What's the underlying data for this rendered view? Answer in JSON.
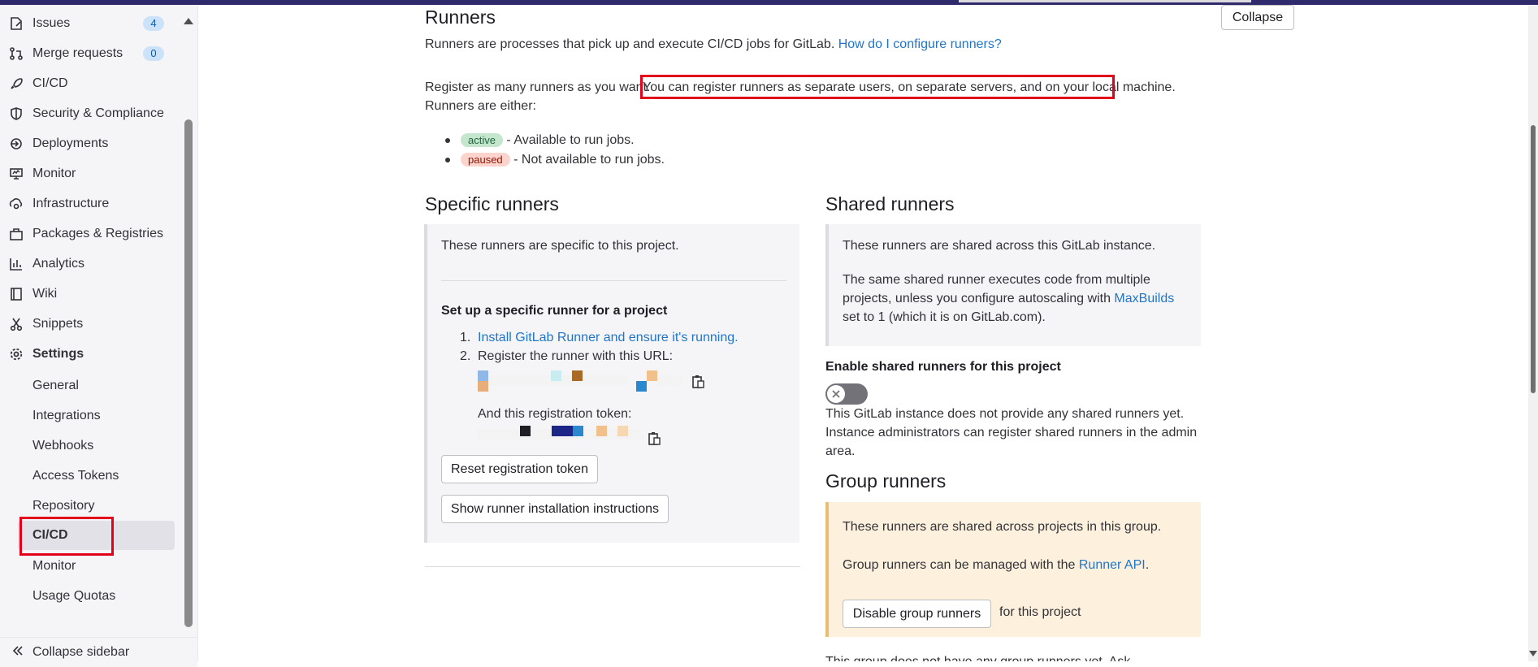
{
  "sidebar": {
    "items": [
      {
        "label": "Issues",
        "icon": "issues-icon",
        "count": "4"
      },
      {
        "label": "Merge requests",
        "icon": "merge-request-icon",
        "count": "0"
      },
      {
        "label": "CI/CD",
        "icon": "rocket-icon"
      },
      {
        "label": "Security & Compliance",
        "icon": "shield-icon"
      },
      {
        "label": "Deployments",
        "icon": "deployments-icon"
      },
      {
        "label": "Monitor",
        "icon": "monitor-icon"
      },
      {
        "label": "Infrastructure",
        "icon": "cloud-gear-icon"
      },
      {
        "label": "Packages & Registries",
        "icon": "package-icon"
      },
      {
        "label": "Analytics",
        "icon": "chart-icon"
      },
      {
        "label": "Wiki",
        "icon": "book-icon"
      },
      {
        "label": "Snippets",
        "icon": "scissors-icon"
      },
      {
        "label": "Settings",
        "icon": "gear-icon"
      }
    ],
    "settings_sub": [
      "General",
      "Integrations",
      "Webhooks",
      "Access Tokens",
      "Repository",
      "CI/CD",
      "Monitor",
      "Usage Quotas"
    ],
    "collapse_label": "Collapse sidebar"
  },
  "main": {
    "title": "Runners",
    "collapse_button": "Collapse",
    "intro": "Runners are processes that pick up and execute CI/CD jobs for GitLab.",
    "intro_link": "How do I configure runners?",
    "register_a": "Register as many runners as you want.",
    "register_b": "You can register runners as separate users, on separate servers, and on your local machine.",
    "either": "Runners are either:",
    "states": [
      {
        "badge": "active",
        "text": "- Available to run jobs."
      },
      {
        "badge": "paused",
        "text": "- Not available to run jobs."
      }
    ],
    "specific": {
      "heading": "Specific runners",
      "desc": "These runners are specific to this project.",
      "setup_title": "Set up a specific runner for a project",
      "step1_num": "1.",
      "step1_link": "Install GitLab Runner and ensure it's running.",
      "step2_num": "2.",
      "step2_text": "Register the runner with this URL:",
      "token_label": "And this registration token:",
      "reset_button": "Reset registration token",
      "show_button": "Show runner installation instructions"
    },
    "shared": {
      "heading": "Shared runners",
      "desc": "These runners are shared across this GitLab instance.",
      "p2_line1": "The same shared runner executes code from multiple",
      "p2_line2a": "projects, unless you configure autoscaling with",
      "p2_link": "MaxBuilds",
      "p2_line3": "set to 1 (which it is on GitLab.com).",
      "enable_label": "Enable shared runners for this project",
      "toggle_on": false,
      "note_line1": "This GitLab instance does not provide any shared runners yet.",
      "note_line2": "Instance administrators can register shared runners in the admin",
      "note_line3": "area."
    },
    "group": {
      "heading": "Group runners",
      "desc": "These runners are shared across projects in this group.",
      "manage_a": "Group runners can be managed with the",
      "manage_link": "Runner API",
      "manage_end": ".",
      "disable_button": "Disable group runners",
      "disable_suffix": "for this project",
      "cut_text": "This group does not have any group runners yet. Ask"
    }
  },
  "colors": {
    "link": "#1f75cb",
    "highlight": "#e3001b",
    "warning_bg": "#fdf1dd"
  }
}
